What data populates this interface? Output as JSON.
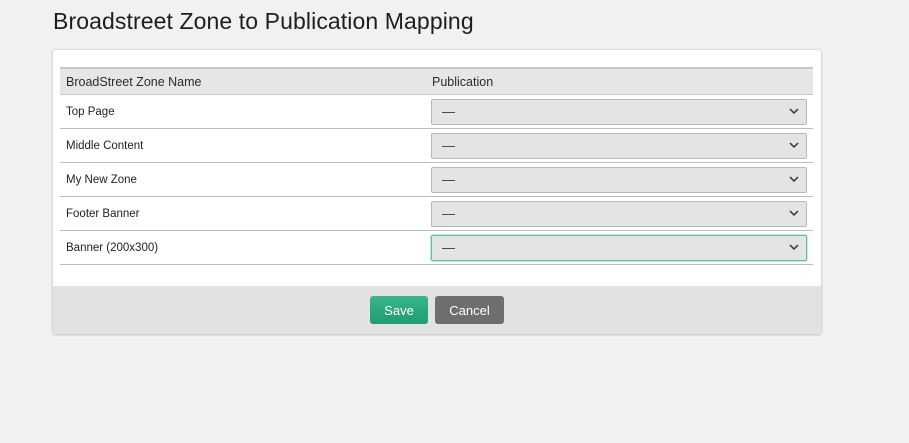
{
  "page": {
    "title": "Broadstreet Zone to Publication Mapping"
  },
  "table": {
    "headers": {
      "zone_name": "BroadStreet Zone Name",
      "publication": "Publication"
    },
    "rows": [
      {
        "zone": "Top Page",
        "publication": "—"
      },
      {
        "zone": "Middle Content",
        "publication": "—"
      },
      {
        "zone": "My New Zone",
        "publication": "—"
      },
      {
        "zone": "Footer Banner",
        "publication": "—"
      },
      {
        "zone": "Banner (200x300)",
        "publication": "—"
      }
    ]
  },
  "actions": {
    "save_label": "Save",
    "cancel_label": "Cancel"
  },
  "colors": {
    "save": "#25a47a",
    "cancel": "#6e6e6e",
    "focus": "#5cc49a"
  },
  "icons": {
    "select": "chevron-down-icon"
  }
}
